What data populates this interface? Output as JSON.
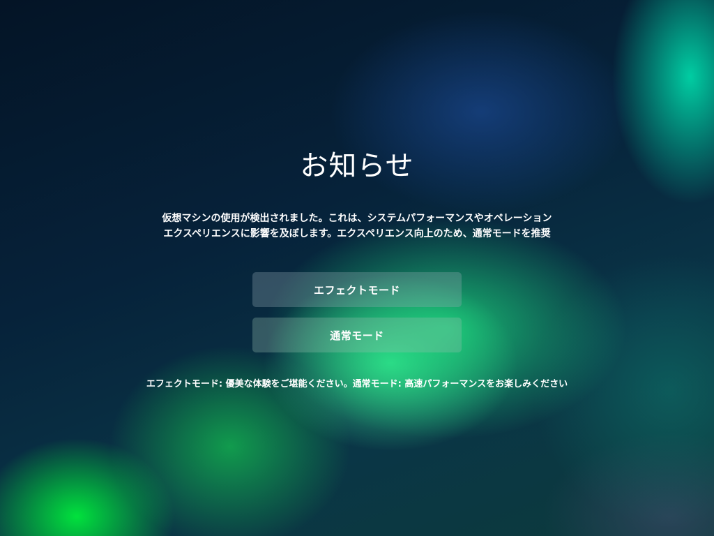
{
  "dialog": {
    "title": "お知らせ",
    "message_lines": [
      "仮想マシンの使用が検出されました。これは、システムパフォーマンスやオペレーション",
      "エクスペリエンスに影響を及ぼします。エクスペリエンス向上のため、通常モードを推奨"
    ],
    "buttons": {
      "effect_mode_label": "エフェクトモード",
      "normal_mode_label": "通常モード"
    },
    "footnote": "エフェクトモード: 優美な体験をご堪能ください。通常モード: 高速パフォーマンスをお楽しみください"
  },
  "colors": {
    "text": "#ffffff",
    "background_dark": "#071a2c",
    "aurora_green": "#1ee682",
    "aurora_teal": "#00d6a8"
  }
}
